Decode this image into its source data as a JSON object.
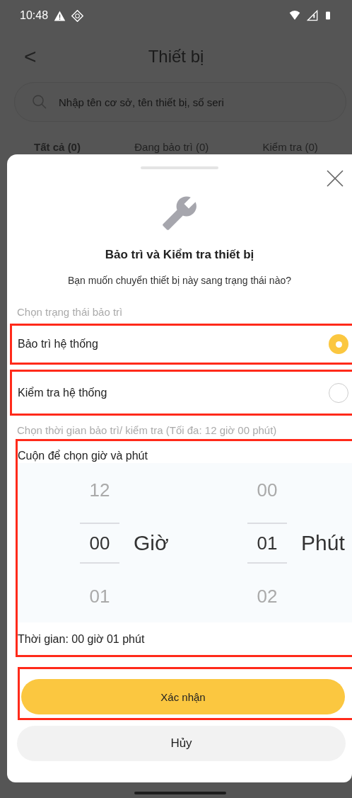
{
  "status_bar": {
    "time": "10:48"
  },
  "header": {
    "back": "<",
    "title": "Thiết bị"
  },
  "search": {
    "placeholder": "Nhập tên cơ sở, tên thiết bị, số seri"
  },
  "tabs": [
    {
      "label": "Tất cả (0)",
      "selected": true
    },
    {
      "label": "Đang bảo trì (0)",
      "selected": false
    },
    {
      "label": "Kiểm tra (0)",
      "selected": false
    }
  ],
  "sheet": {
    "title": "Bảo trì và Kiểm tra thiết bị",
    "subtitle": "Bạn muốn chuyển thiết bị này sang trạng thái nào?",
    "status_label": "Chọn trạng thái bảo trì",
    "options": [
      {
        "label": "Bảo trì hệ thống",
        "selected": true,
        "highlighted": true
      },
      {
        "label": "Kiểm tra hệ thống",
        "selected": false,
        "highlighted": true
      }
    ],
    "time_label": "Chọn thời gian bảo trì/ kiểm tra (Tối đa: 12 giờ 00 phút)",
    "picker": {
      "highlighted": true,
      "hint": "Cuộn để chọn giờ và phút",
      "columns": [
        {
          "unit": "Giờ",
          "items": [
            {
              "value": "12",
              "selected": false
            },
            {
              "value": "00",
              "selected": true
            },
            {
              "value": "01",
              "selected": false
            }
          ]
        },
        {
          "unit": "Phút",
          "items": [
            {
              "value": "00",
              "selected": false
            },
            {
              "value": "01",
              "selected": true
            },
            {
              "value": "02",
              "selected": false
            }
          ]
        }
      ],
      "summary": "Thời gian: 00 giờ 01 phút"
    },
    "confirm": {
      "label": "Xác nhận",
      "highlighted": true
    },
    "cancel": {
      "label": "Hủy"
    }
  }
}
